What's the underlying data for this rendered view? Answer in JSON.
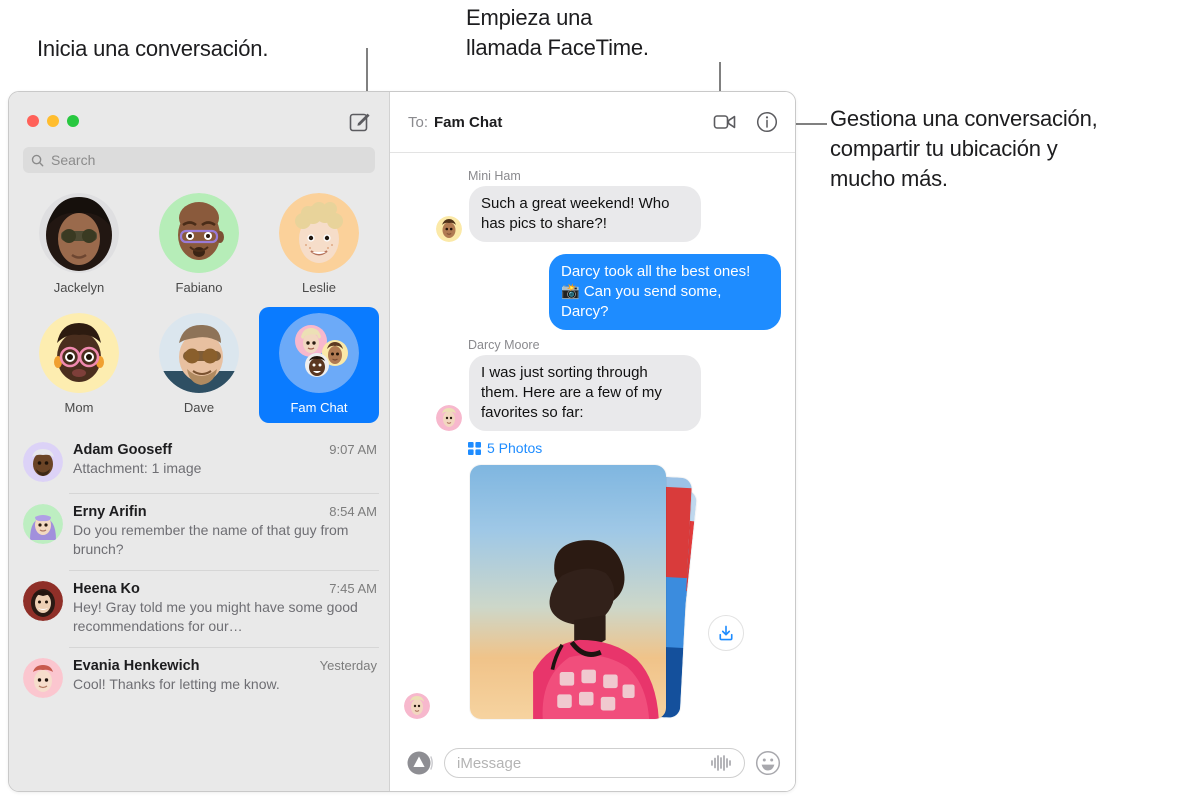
{
  "callouts": [
    {
      "id": "compose",
      "text": "Inicia una conversación."
    },
    {
      "id": "facetime",
      "text": "Empieza una\nllamada FaceTime."
    },
    {
      "id": "details",
      "text": "Gestiona una conversación,\ncompartir tu ubicación y\nmucho más."
    }
  ],
  "window": {
    "traffic_lights": {
      "close_color": "#FF6159",
      "minimize_color": "#FFBD2E",
      "zoom_color": "#28C840"
    }
  },
  "sidebar": {
    "compose_icon": "compose-icon",
    "search": {
      "placeholder": "Search",
      "icon": "search-icon"
    },
    "pinned": [
      {
        "name": "Jackelyn",
        "selected": false
      },
      {
        "name": "Fabiano",
        "selected": false
      },
      {
        "name": "Leslie",
        "selected": false
      },
      {
        "name": "Mom",
        "selected": false
      },
      {
        "name": "Dave",
        "selected": false
      },
      {
        "name": "Fam Chat",
        "selected": true
      }
    ],
    "conversations": [
      {
        "name": "Adam Gooseff",
        "time": "9:07 AM",
        "preview": "Attachment: 1 image"
      },
      {
        "name": "Erny Arifin",
        "time": "8:54 AM",
        "preview": "Do you remember the name of that guy from brunch?"
      },
      {
        "name": "Heena Ko",
        "time": "7:45 AM",
        "preview": "Hey! Gray told me you might have some good recommendations for our…"
      },
      {
        "name": "Evania Henkewich",
        "time": "Yesterday",
        "preview": "Cool! Thanks for letting me know."
      }
    ]
  },
  "chat": {
    "header": {
      "to_label": "To:",
      "to_value": "Fam Chat",
      "facetime_icon": "video-camera-icon",
      "details_icon": "info-circle-icon"
    },
    "messages": [
      {
        "sender": "Mini Ham",
        "text": "Such a great weekend! Who has pics to share?!",
        "direction": "in"
      },
      {
        "sender": "",
        "text": "Darcy took all the best ones! 📸 Can you send some, Darcy?",
        "direction": "out"
      },
      {
        "sender": "Darcy Moore",
        "text": "I was just sorting through them. Here are a few of my favorites so far:",
        "direction": "in"
      }
    ],
    "attachment": {
      "label": "5 Photos",
      "grid_icon": "grid-icon",
      "download_icon": "download-icon"
    },
    "composer": {
      "apps_icon": "app-store-icon",
      "placeholder": "iMessage",
      "audio_icon": "audio-waveform-icon",
      "emoji_icon": "smiley-face-icon"
    }
  },
  "colors": {
    "accent_blue": "#0A7BFF",
    "bubble_out": "#1E8CFF",
    "bubble_in": "#E9E9EB",
    "sidebar_bg": "#E9E9E9"
  }
}
